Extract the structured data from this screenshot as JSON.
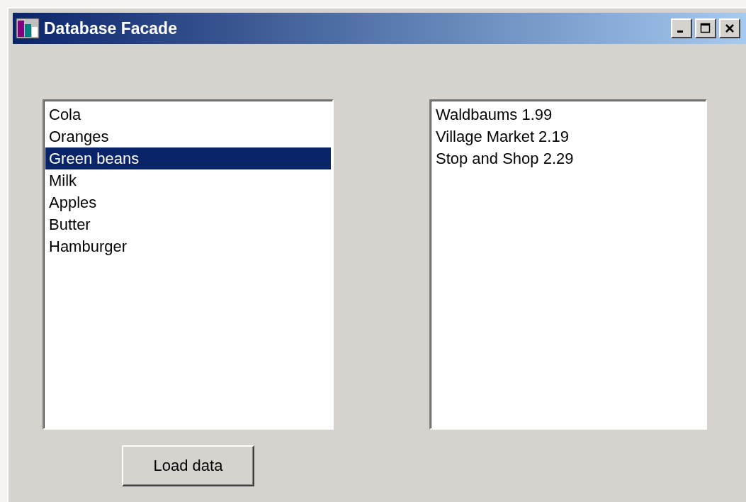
{
  "window": {
    "title": "Database Facade"
  },
  "food_list": {
    "items": [
      {
        "label": "Cola",
        "selected": false
      },
      {
        "label": "Oranges",
        "selected": false
      },
      {
        "label": "Green beans",
        "selected": true
      },
      {
        "label": "Milk",
        "selected": false
      },
      {
        "label": "Apples",
        "selected": false
      },
      {
        "label": "Butter",
        "selected": false
      },
      {
        "label": "Hamburger",
        "selected": false
      }
    ]
  },
  "price_list": {
    "items": [
      {
        "label": "Waldbaums 1.99",
        "selected": false
      },
      {
        "label": "Village Market 2.19",
        "selected": false
      },
      {
        "label": "Stop and Shop 2.29",
        "selected": false
      }
    ]
  },
  "load_button": {
    "label": "Load data"
  }
}
